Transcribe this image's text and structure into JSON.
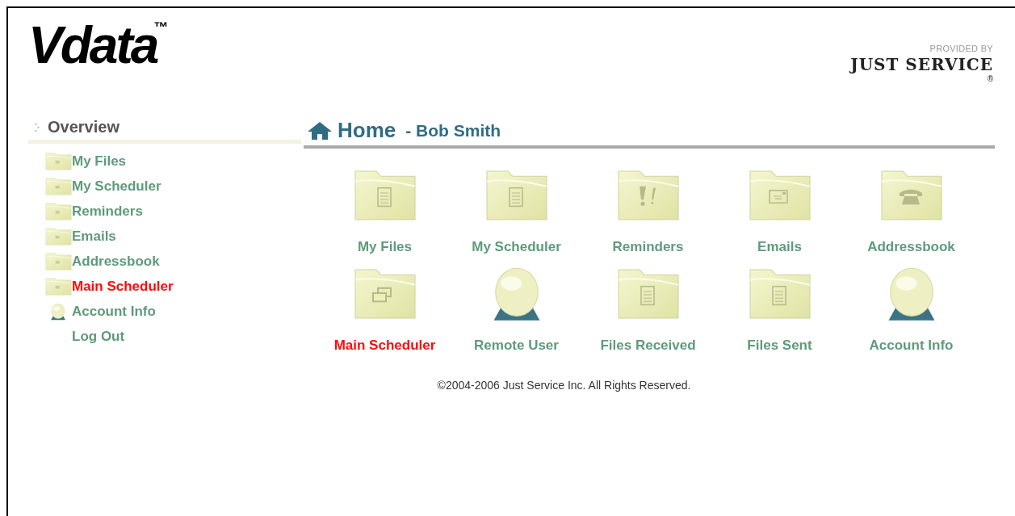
{
  "header": {
    "logo": "Vdata",
    "trademark": "™",
    "provider_caption": "PROVIDED BY",
    "provider_name": "JUST SERVICE",
    "registered": "®"
  },
  "sidebar": {
    "title": "Overview",
    "items": [
      {
        "label": "My Files",
        "kind": "folder",
        "selected": false
      },
      {
        "label": "My Scheduler",
        "kind": "folder",
        "selected": false
      },
      {
        "label": "Reminders",
        "kind": "folder",
        "selected": false
      },
      {
        "label": "Emails",
        "kind": "folder",
        "selected": false
      },
      {
        "label": "Addressbook",
        "kind": "folder",
        "selected": false
      },
      {
        "label": "Main Scheduler",
        "kind": "folder",
        "selected": true
      },
      {
        "label": "Account Info",
        "kind": "user",
        "selected": false
      },
      {
        "label": "Log Out",
        "kind": "plain",
        "selected": false
      }
    ]
  },
  "main": {
    "title": "Home",
    "subtitle": "- Bob Smith",
    "tiles": [
      {
        "label": "My Files",
        "kind": "document",
        "selected": false
      },
      {
        "label": "My Scheduler",
        "kind": "document",
        "selected": false
      },
      {
        "label": "Reminders",
        "kind": "alert",
        "selected": false
      },
      {
        "label": "Emails",
        "kind": "mail",
        "selected": false
      },
      {
        "label": "Addressbook",
        "kind": "phone",
        "selected": false
      },
      {
        "label": "Main Scheduler",
        "kind": "windows",
        "selected": true
      },
      {
        "label": "Remote User",
        "kind": "user",
        "selected": false
      },
      {
        "label": "Files Received",
        "kind": "document",
        "selected": false
      },
      {
        "label": "Files Sent",
        "kind": "document",
        "selected": false
      },
      {
        "label": "Account Info",
        "kind": "user",
        "selected": false
      }
    ]
  },
  "footer": "©2004-2006 Just Service Inc. All Rights Reserved."
}
